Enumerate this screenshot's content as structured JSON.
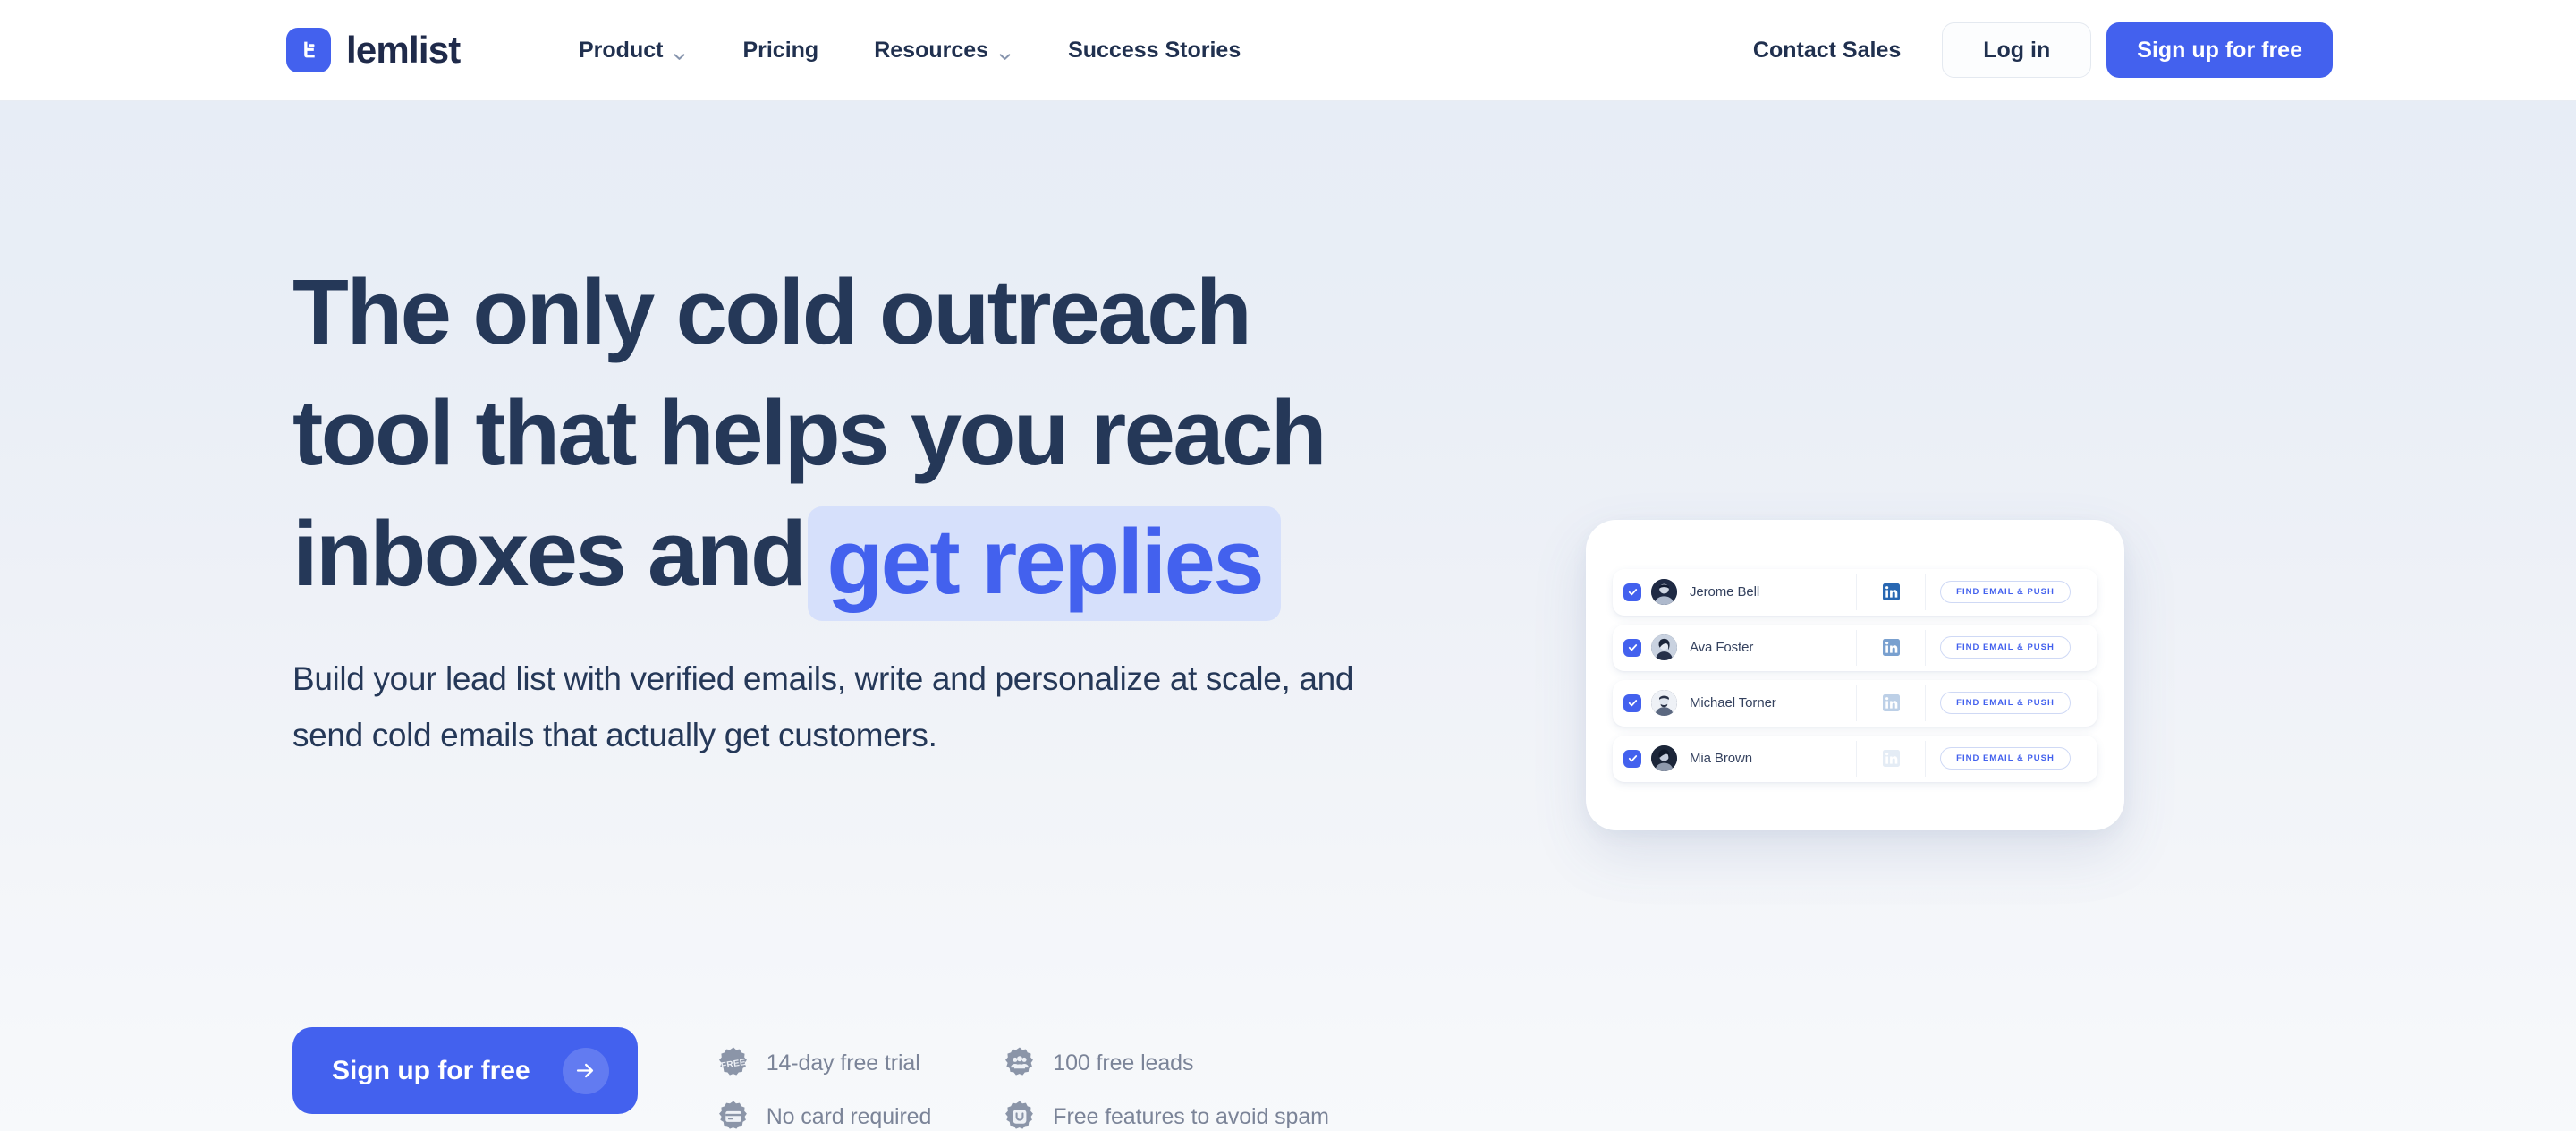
{
  "colors": {
    "brand_blue": "#4361ee",
    "heading_navy": "#253858",
    "highlight_bg": "#d6e0fb",
    "perk_gray": "#7b8498",
    "hero_bg_top": "#e7edf6",
    "hero_bg_bottom": "#f7f9fb"
  },
  "navbar": {
    "brand_name": "lemlist",
    "logo_icon": "lemlist-logo-icon",
    "links": [
      {
        "label": "Product",
        "has_dropdown": true,
        "icon": "chevron-down-icon"
      },
      {
        "label": "Pricing",
        "has_dropdown": false,
        "icon": ""
      },
      {
        "label": "Resources",
        "has_dropdown": true,
        "icon": "chevron-down-icon"
      },
      {
        "label": "Success Stories",
        "has_dropdown": false,
        "icon": ""
      }
    ],
    "contact_sales_label": "Contact Sales",
    "login_label": "Log in",
    "signup_label": "Sign up for free"
  },
  "hero": {
    "headline_line1": "The only cold outreach",
    "headline_line2": "tool that helps you reach",
    "headline_line3_prefix": "inboxes and",
    "headline_highlight": "get replies",
    "subheadline": "Build your lead list with verified emails, write and personalize at scale, and send cold emails that actually get customers.",
    "cta_label": "Sign up for free",
    "cta_icon": "arrow-right-icon",
    "perks": [
      {
        "label": "14-day free trial",
        "icon": "free-badge-icon"
      },
      {
        "label": "100 free leads",
        "icon": "people-badge-icon"
      },
      {
        "label": "No card required",
        "icon": "card-badge-icon"
      },
      {
        "label": "Free features to avoid spam",
        "icon": "unsubscribe-badge-icon"
      }
    ]
  },
  "lead_card": {
    "action_label": "FIND EMAIL & PUSH",
    "social_icon": "linkedin-icon",
    "checkbox_icon": "checkmark-icon",
    "rows": [
      {
        "name": "Jerome Bell",
        "checked": true,
        "social_opacity": 1.0
      },
      {
        "name": "Ava Foster",
        "checked": true,
        "social_opacity": 0.62
      },
      {
        "name": "Michael Torner",
        "checked": true,
        "social_opacity": 0.3
      },
      {
        "name": "Mia Brown",
        "checked": true,
        "social_opacity": 0.12
      }
    ]
  }
}
